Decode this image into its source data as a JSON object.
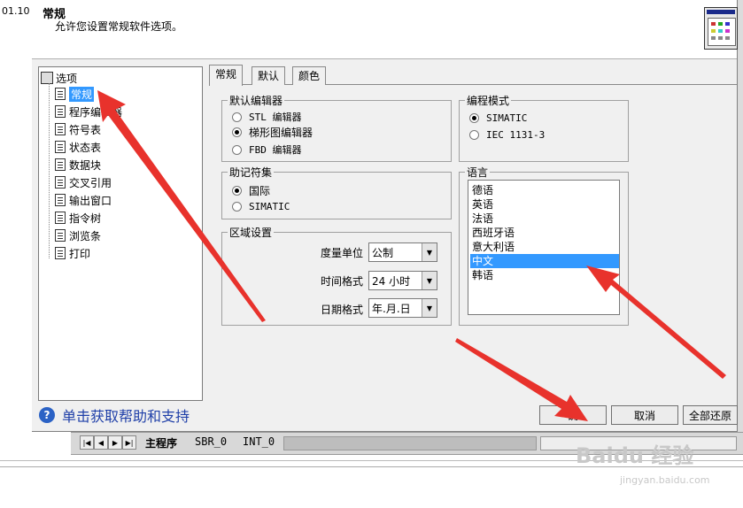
{
  "background_app": {
    "left_text": "01.10",
    "sheet_tabs": [
      "主程序",
      "SBR_0",
      "INT_0"
    ]
  },
  "dialog": {
    "title": "常规",
    "description": "允许您设置常规软件选项。",
    "tree": {
      "root": "选项",
      "items": [
        "常规",
        "程序编辑器",
        "符号表",
        "状态表",
        "数据块",
        "交叉引用",
        "输出窗口",
        "指令树",
        "浏览条",
        "打印"
      ],
      "selected_index": 0
    },
    "tabs": [
      "常规",
      "默认",
      "颜色"
    ],
    "active_tab": 0,
    "default_editor": {
      "legend": "默认编辑器",
      "options": [
        "STL 编辑器",
        "梯形图编辑器",
        "FBD 编辑器"
      ],
      "selected": 1
    },
    "mnemonic": {
      "legend": "助记符集",
      "options": [
        "国际",
        "SIMATIC"
      ],
      "selected": 0
    },
    "region": {
      "legend": "区域设置",
      "measure_label": "度量单位",
      "measure_value": "公制",
      "time_label": "时间格式",
      "time_value": "24 小时",
      "date_label": "日期格式",
      "date_value": "年.月.日"
    },
    "programming_mode": {
      "legend": "编程模式",
      "options": [
        "SIMATIC",
        "IEC 1131-3"
      ],
      "selected": 0
    },
    "language": {
      "legend": "语言",
      "items": [
        "德语",
        "英语",
        "法语",
        "西班牙语",
        "意大利语",
        "中文",
        "韩语"
      ],
      "selected": 5
    },
    "help_text": "单击获取帮助和支持",
    "buttons": {
      "ok": "确",
      "cancel": "取消",
      "restore_all": "全部还原"
    }
  },
  "watermark": {
    "main": "Baidu 经验",
    "sub": "jingyan.baidu.com"
  },
  "colors": {
    "selection": "#3399ff",
    "arrow": "#e8322c",
    "help_text": "#1f3fa8"
  }
}
